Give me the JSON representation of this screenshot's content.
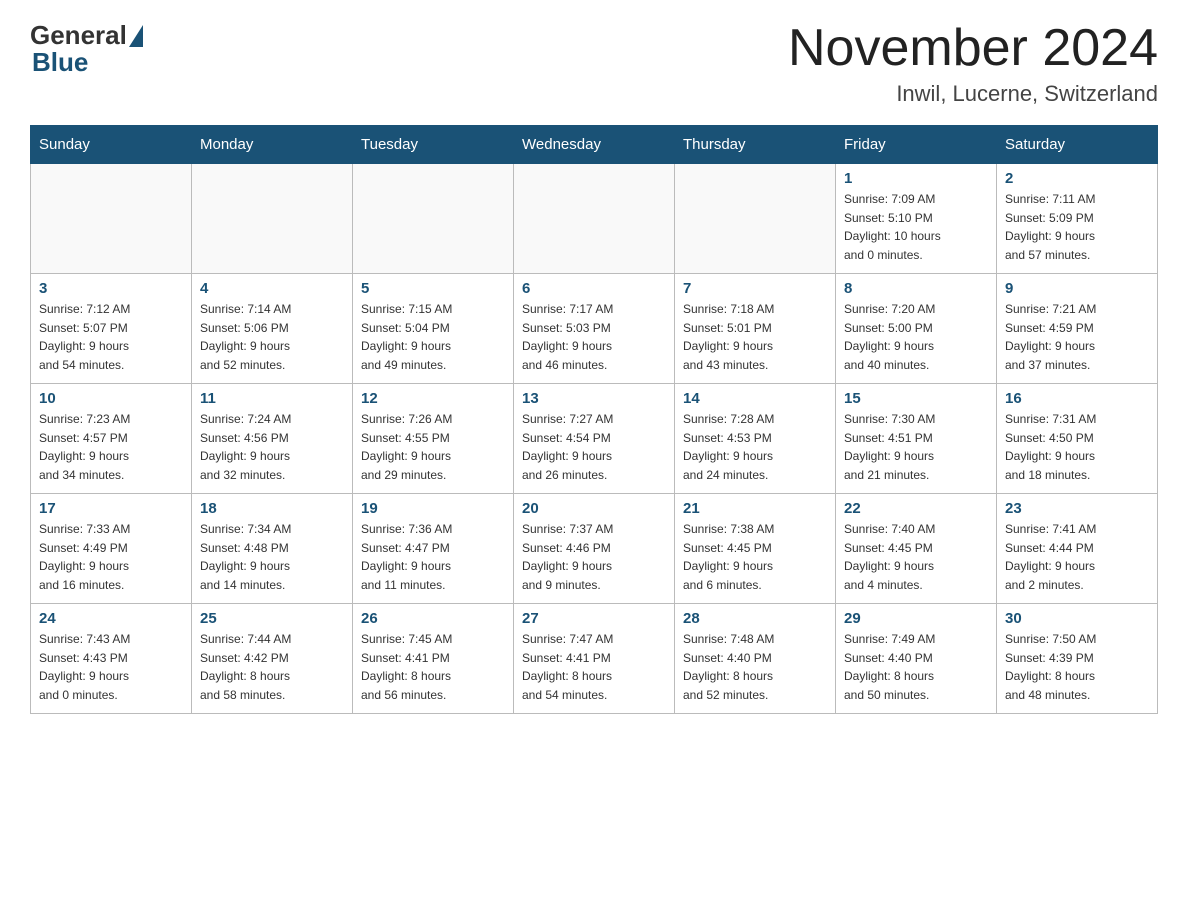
{
  "header": {
    "logo_text": "General",
    "logo_blue": "Blue",
    "month_title": "November 2024",
    "location": "Inwil, Lucerne, Switzerland"
  },
  "days_of_week": [
    "Sunday",
    "Monday",
    "Tuesday",
    "Wednesday",
    "Thursday",
    "Friday",
    "Saturday"
  ],
  "weeks": [
    [
      {
        "day": "",
        "info": ""
      },
      {
        "day": "",
        "info": ""
      },
      {
        "day": "",
        "info": ""
      },
      {
        "day": "",
        "info": ""
      },
      {
        "day": "",
        "info": ""
      },
      {
        "day": "1",
        "info": "Sunrise: 7:09 AM\nSunset: 5:10 PM\nDaylight: 10 hours\nand 0 minutes."
      },
      {
        "day": "2",
        "info": "Sunrise: 7:11 AM\nSunset: 5:09 PM\nDaylight: 9 hours\nand 57 minutes."
      }
    ],
    [
      {
        "day": "3",
        "info": "Sunrise: 7:12 AM\nSunset: 5:07 PM\nDaylight: 9 hours\nand 54 minutes."
      },
      {
        "day": "4",
        "info": "Sunrise: 7:14 AM\nSunset: 5:06 PM\nDaylight: 9 hours\nand 52 minutes."
      },
      {
        "day": "5",
        "info": "Sunrise: 7:15 AM\nSunset: 5:04 PM\nDaylight: 9 hours\nand 49 minutes."
      },
      {
        "day": "6",
        "info": "Sunrise: 7:17 AM\nSunset: 5:03 PM\nDaylight: 9 hours\nand 46 minutes."
      },
      {
        "day": "7",
        "info": "Sunrise: 7:18 AM\nSunset: 5:01 PM\nDaylight: 9 hours\nand 43 minutes."
      },
      {
        "day": "8",
        "info": "Sunrise: 7:20 AM\nSunset: 5:00 PM\nDaylight: 9 hours\nand 40 minutes."
      },
      {
        "day": "9",
        "info": "Sunrise: 7:21 AM\nSunset: 4:59 PM\nDaylight: 9 hours\nand 37 minutes."
      }
    ],
    [
      {
        "day": "10",
        "info": "Sunrise: 7:23 AM\nSunset: 4:57 PM\nDaylight: 9 hours\nand 34 minutes."
      },
      {
        "day": "11",
        "info": "Sunrise: 7:24 AM\nSunset: 4:56 PM\nDaylight: 9 hours\nand 32 minutes."
      },
      {
        "day": "12",
        "info": "Sunrise: 7:26 AM\nSunset: 4:55 PM\nDaylight: 9 hours\nand 29 minutes."
      },
      {
        "day": "13",
        "info": "Sunrise: 7:27 AM\nSunset: 4:54 PM\nDaylight: 9 hours\nand 26 minutes."
      },
      {
        "day": "14",
        "info": "Sunrise: 7:28 AM\nSunset: 4:53 PM\nDaylight: 9 hours\nand 24 minutes."
      },
      {
        "day": "15",
        "info": "Sunrise: 7:30 AM\nSunset: 4:51 PM\nDaylight: 9 hours\nand 21 minutes."
      },
      {
        "day": "16",
        "info": "Sunrise: 7:31 AM\nSunset: 4:50 PM\nDaylight: 9 hours\nand 18 minutes."
      }
    ],
    [
      {
        "day": "17",
        "info": "Sunrise: 7:33 AM\nSunset: 4:49 PM\nDaylight: 9 hours\nand 16 minutes."
      },
      {
        "day": "18",
        "info": "Sunrise: 7:34 AM\nSunset: 4:48 PM\nDaylight: 9 hours\nand 14 minutes."
      },
      {
        "day": "19",
        "info": "Sunrise: 7:36 AM\nSunset: 4:47 PM\nDaylight: 9 hours\nand 11 minutes."
      },
      {
        "day": "20",
        "info": "Sunrise: 7:37 AM\nSunset: 4:46 PM\nDaylight: 9 hours\nand 9 minutes."
      },
      {
        "day": "21",
        "info": "Sunrise: 7:38 AM\nSunset: 4:45 PM\nDaylight: 9 hours\nand 6 minutes."
      },
      {
        "day": "22",
        "info": "Sunrise: 7:40 AM\nSunset: 4:45 PM\nDaylight: 9 hours\nand 4 minutes."
      },
      {
        "day": "23",
        "info": "Sunrise: 7:41 AM\nSunset: 4:44 PM\nDaylight: 9 hours\nand 2 minutes."
      }
    ],
    [
      {
        "day": "24",
        "info": "Sunrise: 7:43 AM\nSunset: 4:43 PM\nDaylight: 9 hours\nand 0 minutes."
      },
      {
        "day": "25",
        "info": "Sunrise: 7:44 AM\nSunset: 4:42 PM\nDaylight: 8 hours\nand 58 minutes."
      },
      {
        "day": "26",
        "info": "Sunrise: 7:45 AM\nSunset: 4:41 PM\nDaylight: 8 hours\nand 56 minutes."
      },
      {
        "day": "27",
        "info": "Sunrise: 7:47 AM\nSunset: 4:41 PM\nDaylight: 8 hours\nand 54 minutes."
      },
      {
        "day": "28",
        "info": "Sunrise: 7:48 AM\nSunset: 4:40 PM\nDaylight: 8 hours\nand 52 minutes."
      },
      {
        "day": "29",
        "info": "Sunrise: 7:49 AM\nSunset: 4:40 PM\nDaylight: 8 hours\nand 50 minutes."
      },
      {
        "day": "30",
        "info": "Sunrise: 7:50 AM\nSunset: 4:39 PM\nDaylight: 8 hours\nand 48 minutes."
      }
    ]
  ]
}
